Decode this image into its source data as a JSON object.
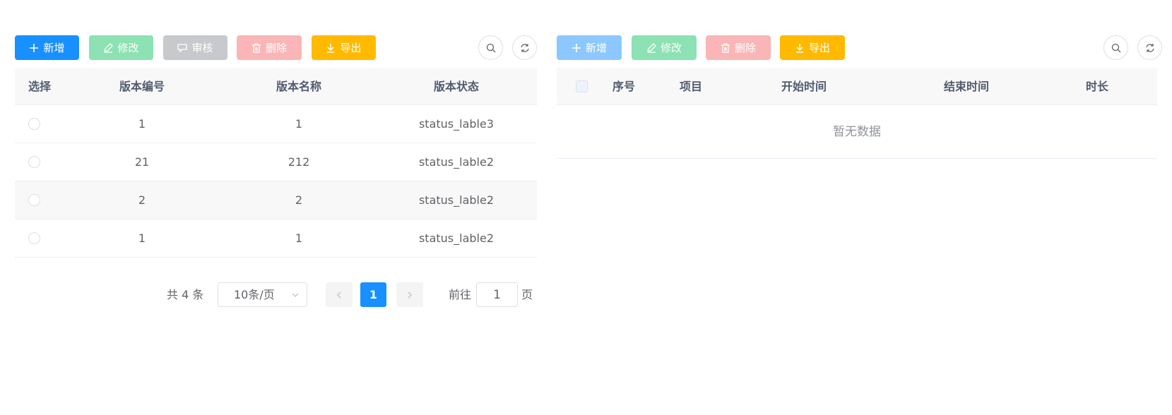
{
  "left_panel": {
    "toolbar": {
      "add_label": "新增",
      "edit_label": "修改",
      "audit_label": "审核",
      "delete_label": "删除",
      "export_label": "导出"
    },
    "table": {
      "headers": [
        "选择",
        "版本编号",
        "版本名称",
        "版本状态"
      ],
      "rows": [
        {
          "code": "1",
          "name": "1",
          "status": "status_lable3"
        },
        {
          "code": "21",
          "name": "212",
          "status": "status_lable2"
        },
        {
          "code": "2",
          "name": "2",
          "status": "status_lable2"
        },
        {
          "code": "1",
          "name": "1",
          "status": "status_lable2"
        }
      ]
    },
    "pagination": {
      "total_text": "共 4 条",
      "page_size": "10条/页",
      "current_page": "1",
      "goto_label": "前往",
      "goto_value": "1",
      "page_unit": "页"
    }
  },
  "right_panel": {
    "toolbar": {
      "add_label": "新增",
      "edit_label": "修改",
      "delete_label": "删除",
      "export_label": "导出"
    },
    "table": {
      "headers": [
        "序号",
        "项目",
        "开始时间",
        "结束时间",
        "时长"
      ],
      "empty_text": "暂无数据"
    }
  },
  "colors": {
    "primary": "#1890ff",
    "success_light": "#8ce2b2",
    "info_light": "#c8c9cc",
    "danger_light": "#fab6b6",
    "warning": "#ffba00"
  }
}
